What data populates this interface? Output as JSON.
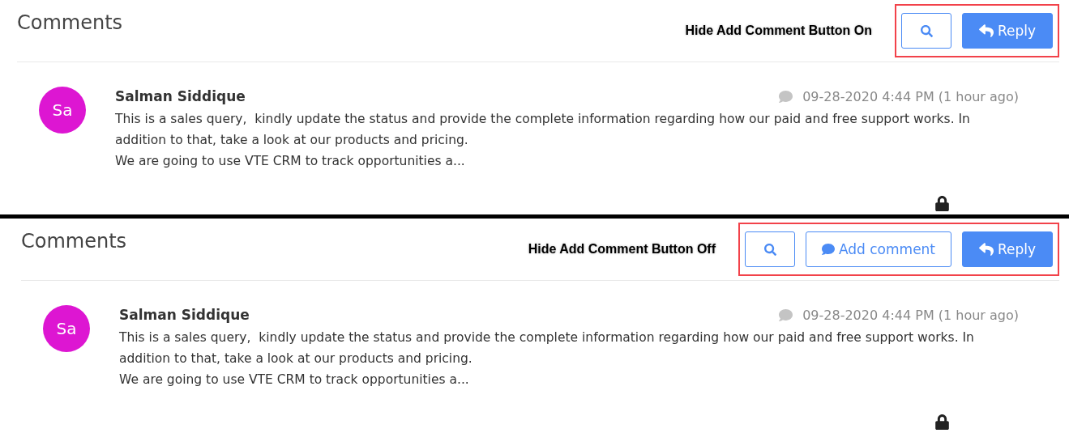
{
  "panels": [
    {
      "title": "Comments",
      "annotation": "Hide Add Comment Button On",
      "buttons": [
        {
          "kind": "search"
        },
        {
          "kind": "reply",
          "label": "Reply"
        }
      ],
      "comment": {
        "initials": "Sa",
        "color": "#dd16d2",
        "author": "Salman Siddique",
        "time": "09-28-2020 4:44 PM (1 hour ago)",
        "lines": [
          "This is a sales query,  kindly update the status and provide the complete information regarding how our paid and free support works. In",
          "addition to that, take a look at our products and pricing.",
          "We are going to use VTE CRM to track opportunities a..."
        ]
      }
    },
    {
      "title": "Comments",
      "annotation": "Hide Add Comment Button Off",
      "buttons": [
        {
          "kind": "search"
        },
        {
          "kind": "add_comment",
          "label": "Add comment"
        },
        {
          "kind": "reply",
          "label": "Reply"
        }
      ],
      "comment": {
        "initials": "Sa",
        "color": "#dd16d2",
        "author": "Salman Siddique",
        "time": "09-28-2020 4:44 PM (1 hour ago)",
        "lines": [
          "This is a sales query,  kindly update the status and provide the complete information regarding how our paid and free support works. In",
          "addition to that, take a look at our products and pricing.",
          "We are going to use VTE CRM to track opportunities a..."
        ]
      }
    }
  ]
}
